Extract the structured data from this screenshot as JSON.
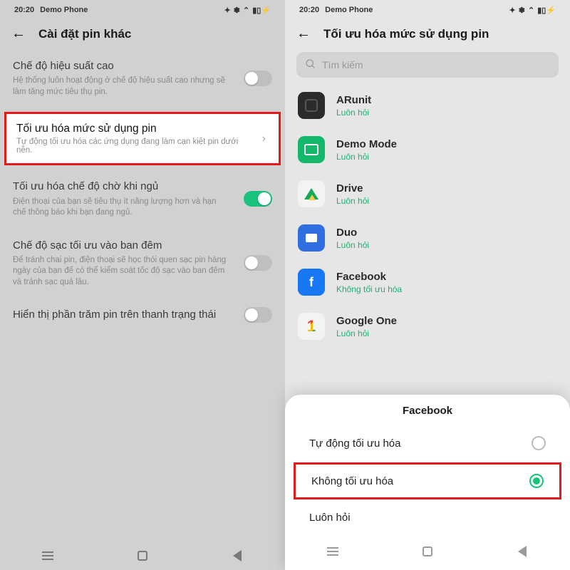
{
  "status": {
    "time": "20:20",
    "device": "Demo Phone"
  },
  "left": {
    "title": "Cài đặt pin khác",
    "rows": {
      "perf": {
        "title": "Chế độ hiệu suất cao",
        "desc": "Hệ thống luôn hoạt động ở chế độ hiệu suất cao nhưng sẽ làm tăng mức tiêu thụ pin."
      },
      "opt": {
        "title": "Tối ưu hóa mức sử dụng pin",
        "desc": "Tự động tối ưu hóa các ứng dụng đang làm cạn kiệt pin dưới nền."
      },
      "sleep": {
        "title": "Tối ưu hóa chế độ chờ khi ngủ",
        "desc": "Điện thoại của bạn sẽ tiêu thụ ít năng lượng hơn và hạn chế thông báo khi bạn đang ngủ."
      },
      "night": {
        "title": "Chế độ sạc tối ưu vào ban đêm",
        "desc": "Để tránh chai pin, điện thoại sẽ học thói quen sạc pin hàng ngày của bạn để có thể kiểm soát tốc độ sạc vào ban đêm và tránh sạc quá lâu."
      },
      "pct": {
        "title": "Hiển thị phần trăm pin trên thanh trạng thái"
      }
    }
  },
  "right": {
    "title": "Tối ưu hóa mức sử dụng pin",
    "search_placeholder": "Tìm kiếm",
    "status_always": "Luôn hỏi",
    "status_no": "Không tối ưu hóa",
    "apps": {
      "arunit": "ARunit",
      "demo": "Demo Mode",
      "drive": "Drive",
      "duo": "Duo",
      "fb": "Facebook",
      "gone": "Google One"
    },
    "sheet": {
      "title": "Facebook",
      "opt_auto": "Tự động tối ưu hóa",
      "opt_no": "Không tối ưu hóa",
      "opt_always": "Luôn hỏi"
    }
  }
}
